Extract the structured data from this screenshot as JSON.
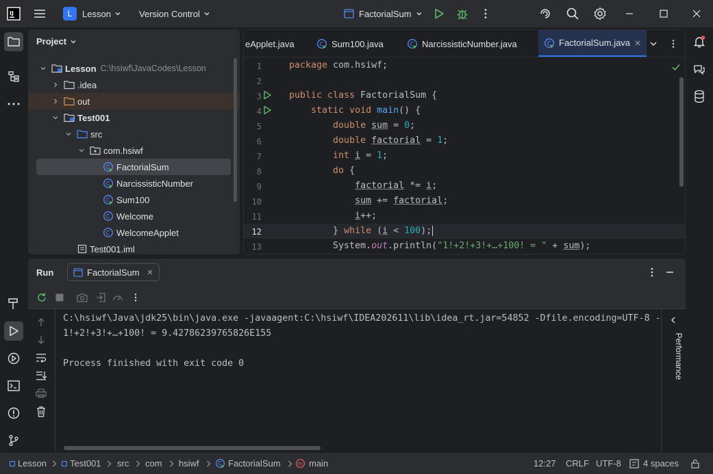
{
  "titlebar": {
    "project_badge": "L",
    "project_name": "Lesson",
    "vcs_label": "Version Control",
    "run_config": "FactorialSum"
  },
  "project_panel": {
    "title": "Project",
    "tree": [
      {
        "label": "Lesson",
        "path": "C:\\hsiwf\\JavaCodes\\Lesson"
      },
      {
        "label": ".idea"
      },
      {
        "label": "out"
      },
      {
        "label": "Test001"
      },
      {
        "label": "src"
      },
      {
        "label": "com.hsiwf"
      },
      {
        "label": "FactorialSum"
      },
      {
        "label": "NarcissisticNumber"
      },
      {
        "label": "Sum100"
      },
      {
        "label": "Welcome"
      },
      {
        "label": "WelcomeApplet"
      },
      {
        "label": "Test001.iml"
      }
    ]
  },
  "editor": {
    "tabs": [
      {
        "label": "eApplet.java"
      },
      {
        "label": "Sum100.java"
      },
      {
        "label": "NarcissisticNumber.java"
      },
      {
        "label": "FactorialSum.java"
      }
    ],
    "line_numbers": [
      "1",
      "2",
      "3",
      "4",
      "5",
      "6",
      "7",
      "8",
      "9",
      "10",
      "11",
      "12",
      "13"
    ],
    "current_line": "12"
  },
  "run_panel": {
    "title": "Run",
    "tab_label": "FactorialSum",
    "output": [
      "C:\\hsiwf\\Java\\jdk25\\bin\\java.exe -javaagent:C:\\hsiwf\\IDEA202611\\lib\\idea_rt.jar=54852 -Dfile.encoding=UTF-8 -",
      "1!+2!+3!+…+100! = 9.42786239765826E155",
      "",
      "Process finished with exit code 0"
    ],
    "side_label": "Performance"
  },
  "statusbar": {
    "crumbs": [
      "Lesson",
      "Test001",
      "src",
      "com",
      "hsiwf",
      "FactorialSum",
      "main"
    ],
    "position": "12:27",
    "line_sep": "CRLF",
    "encoding": "UTF-8",
    "indent": "4 spaces"
  },
  "colors": {
    "accent": "#3574f0",
    "run_green": "#5fb865",
    "keyword": "#cf8e6d",
    "function": "#56a8f5",
    "number": "#2aacb8",
    "string": "#6aab73"
  }
}
